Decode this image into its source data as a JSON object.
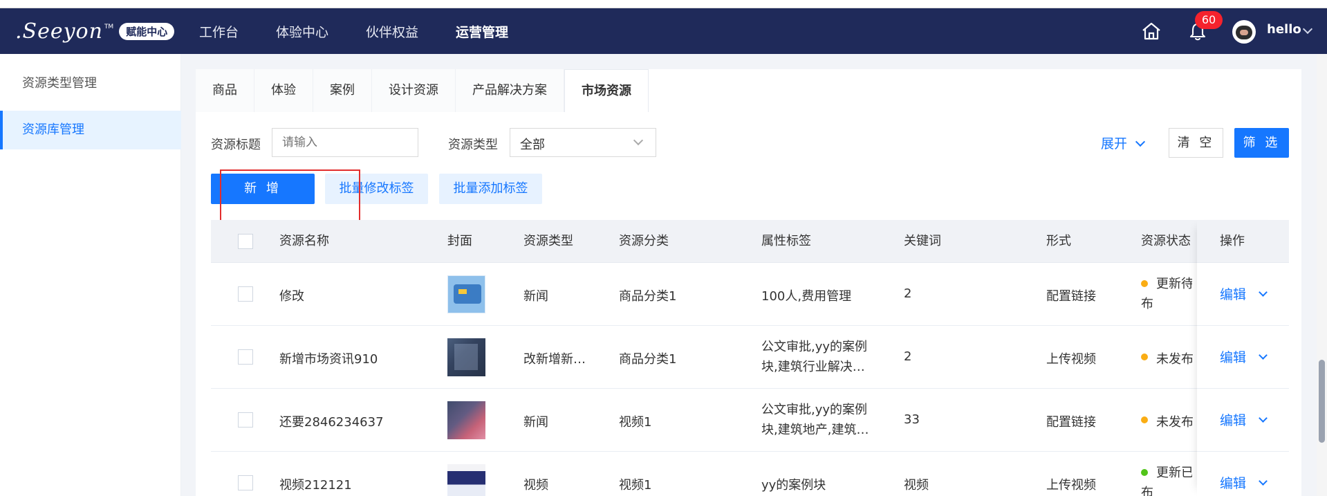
{
  "window": {
    "colors": {
      "navbar_bg": "#1f2a5a",
      "primary": "#1677ff",
      "page_bg": "#f2f4f8",
      "danger": "#f5222d",
      "status_orange": "#faad14",
      "status_green": "#52c41a"
    }
  },
  "navbar": {
    "logo_text": ".Seeyon",
    "logo_tm": "TM",
    "logo_badge": "赋能中心",
    "items": [
      {
        "label": "工作台"
      },
      {
        "label": "体验中心"
      },
      {
        "label": "伙伴权益"
      },
      {
        "label": "运营管理"
      }
    ],
    "active_item": "运营管理",
    "notification_count": "60",
    "username": "hello",
    "icons": [
      "home-icon",
      "bell-icon",
      "avatar",
      "chevron-down-icon"
    ]
  },
  "sidebar": {
    "items": [
      {
        "label": "资源类型管理"
      },
      {
        "label": "资源库管理"
      }
    ],
    "active_item": "资源库管理"
  },
  "tabs": {
    "items": [
      {
        "label": "商品"
      },
      {
        "label": "体验"
      },
      {
        "label": "案例"
      },
      {
        "label": "设计资源"
      },
      {
        "label": "产品解决方案"
      },
      {
        "label": "市场资源"
      }
    ],
    "active_tab": "市场资源"
  },
  "filters": {
    "title_label": "资源标题",
    "title_placeholder": "请输入",
    "type_label": "资源类型",
    "type_value": "全部",
    "expand_label": "展开",
    "clear_label": "清 空",
    "filter_label": "筛 选"
  },
  "actions": {
    "add_label": "新 增",
    "batch_edit_tags_label": "批量修改标签",
    "batch_add_tags_label": "批量添加标签"
  },
  "table": {
    "columns": [
      "资源名称",
      "封面",
      "资源类型",
      "资源分类",
      "属性标签",
      "关键词",
      "形式",
      "资源状态",
      "操作"
    ],
    "rows": [
      {
        "name": "修改",
        "cover": "card-cover",
        "type": "新闻",
        "category": "商品分类1",
        "tags": [
          "100人,费用管理"
        ],
        "keywords": "2",
        "format": "配置链接",
        "status": [
          "更新待",
          "布"
        ],
        "status_color": "orange",
        "action": "编辑"
      },
      {
        "name": "新增市场资讯910",
        "cover": "denim-cover",
        "type": "改新增新…",
        "category": "商品分类1",
        "tags": [
          "公文审批,yy的案例",
          "块,建筑行业解决…"
        ],
        "keywords": "2",
        "format": "上传视频",
        "status": [
          "未发布"
        ],
        "status_color": "orange",
        "action": "编辑"
      },
      {
        "name": "还要2846234637",
        "cover": "baby-cover",
        "type": "新闻",
        "category": "视频1",
        "tags": [
          "公文审批,yy的案例",
          "块,建筑地产,建筑…"
        ],
        "keywords": "33",
        "format": "配置链接",
        "status": [
          "未发布"
        ],
        "status_color": "orange",
        "action": "编辑"
      },
      {
        "name": "视频212121",
        "cover": "screen-cover",
        "type": "视频",
        "category": "视频1",
        "tags": [
          "yy的案例块"
        ],
        "keywords": "视频",
        "format": "上传视频",
        "status": [
          "更新已",
          "布"
        ],
        "status_color": "green",
        "action": "编辑"
      }
    ]
  }
}
